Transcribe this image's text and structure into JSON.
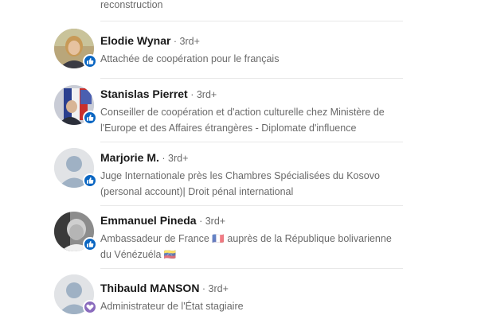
{
  "top_item": {
    "description_tail": "reconstruction"
  },
  "people": [
    {
      "name": "Elodie Wynar",
      "degree": " · 3rd+",
      "headline": "Attachée de coopération pour le français",
      "badge_icon": "thumbs-up-icon",
      "avatar": "photo"
    },
    {
      "name": "Stanislas Pierret",
      "degree": " · 3rd+",
      "headline": "Conseiller de coopération et d'action culturelle chez Ministère de l'Europe et des Affaires étrangères - Diplomate d'influence",
      "badge_icon": "thumbs-up-icon",
      "avatar": "photo"
    },
    {
      "name": "Marjorie M.",
      "degree": " · 3rd+",
      "headline": "Juge Internationale près les Chambres Spécialisées du Kosovo (personal account)| Droit pénal international",
      "badge_icon": "thumbs-up-icon",
      "avatar": "placeholder"
    },
    {
      "name": "Emmanuel Pineda",
      "degree": " · 3rd+",
      "headline": "Ambassadeur de France 🇨🇵 auprès de la République bolivarienne du Vénézuéla 🇻🇪",
      "badge_icon": "thumbs-up-icon",
      "avatar": "photo"
    },
    {
      "name": "Thibauld MANSON",
      "degree": " · 3rd+",
      "headline": "Administrateur de l'État stagiaire",
      "badge_icon": "heart-icon",
      "avatar": "placeholder"
    }
  ],
  "colors": {
    "badge_like": "#0a66c2",
    "badge_love": "#8a6bbd"
  }
}
